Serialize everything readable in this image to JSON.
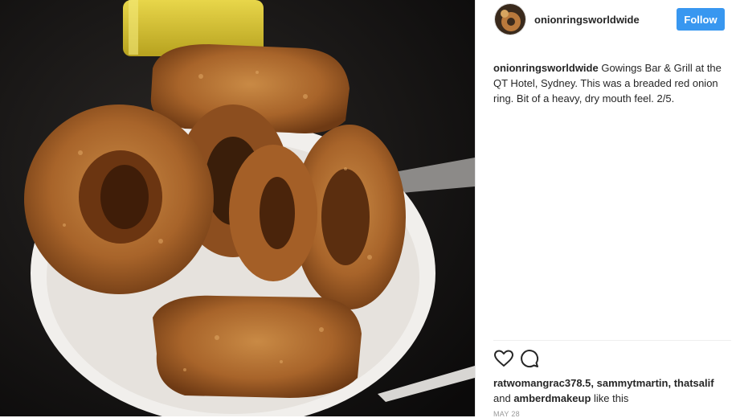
{
  "post": {
    "username": "onionringsworldwide",
    "follow_label": "Follow",
    "caption_user": "onionringsworldwide",
    "caption_text": " Gowings Bar & Grill at the QT Hotel, Sydney. This was a breaded red onion ring. Bit of a heavy, dry mouth feel. 2/5.",
    "likes_names": "ratwomangrac378.5, sammytmartin, thatsalif",
    "likes_and": "and ",
    "likes_last": "amberdmakeup",
    "likes_suffix": " like this",
    "date": "MAY 28"
  },
  "icons": {
    "like": "heart-icon",
    "comment": "comment-icon"
  },
  "colors": {
    "follow_button": "#3897f0",
    "text": "#262626"
  }
}
